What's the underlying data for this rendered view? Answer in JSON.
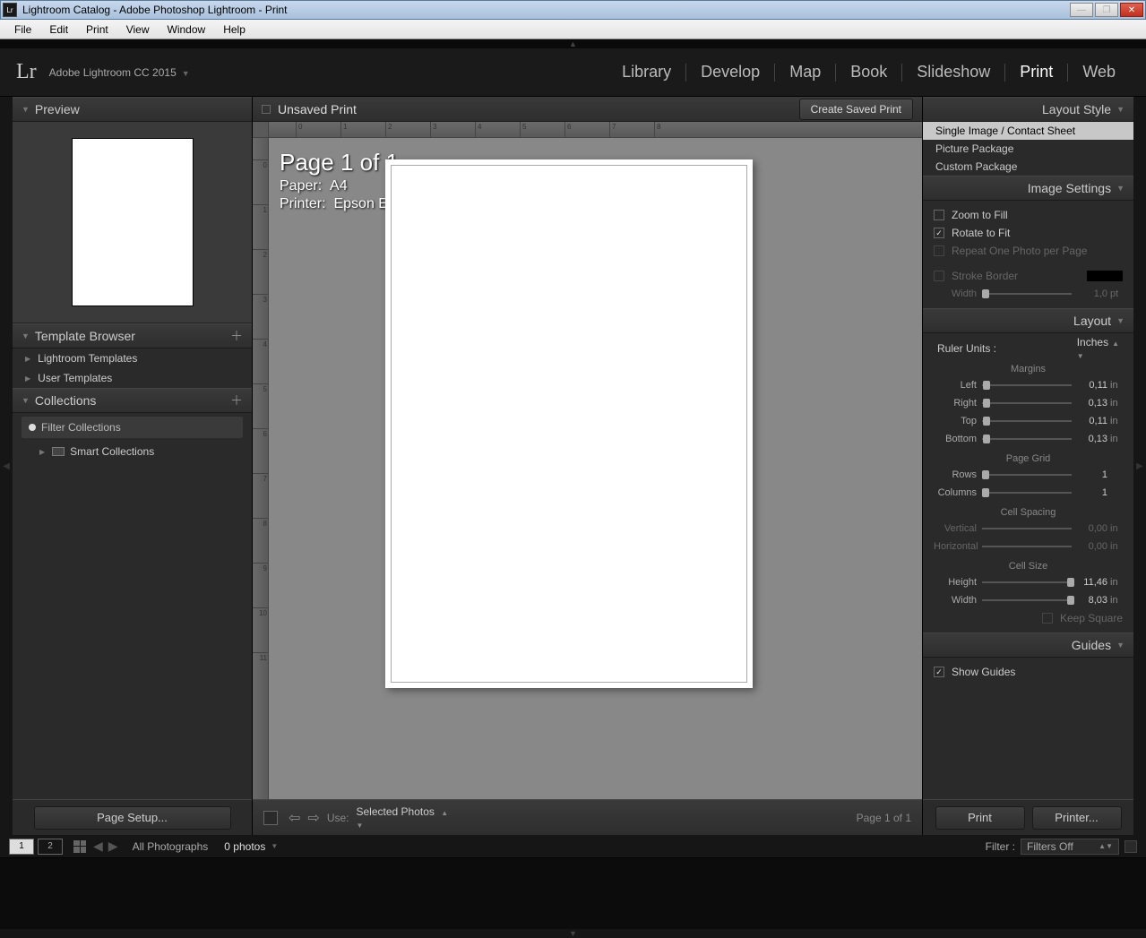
{
  "window": {
    "icon_text": "Lr",
    "title": "Lightroom Catalog - Adobe Photoshop Lightroom - Print"
  },
  "menu": [
    "File",
    "Edit",
    "Print",
    "View",
    "Window",
    "Help"
  ],
  "header": {
    "logo": "Lr",
    "product": "Adobe Lightroom CC 2015",
    "modules": [
      "Library",
      "Develop",
      "Map",
      "Book",
      "Slideshow",
      "Print",
      "Web"
    ],
    "active_module": "Print"
  },
  "left": {
    "preview_title": "Preview",
    "template_browser": "Template Browser",
    "templates": [
      "Lightroom Templates",
      "User Templates"
    ],
    "collections_title": "Collections",
    "filter_placeholder": "Filter Collections",
    "smart_collections": "Smart Collections",
    "page_setup": "Page Setup..."
  },
  "center": {
    "title": "Unsaved Print",
    "save_btn": "Create Saved Print",
    "page_line": "Page 1 of 1",
    "paper_label": "Paper:",
    "paper_value": "A4",
    "printer_label": "Printer:",
    "printer_value": "Epson ESC/P-R",
    "use_label": "Use:",
    "use_value": "Selected Photos",
    "page_status": "Page 1 of 1"
  },
  "right": {
    "layout_style": {
      "title": "Layout Style",
      "items": [
        "Single Image / Contact Sheet",
        "Picture Package",
        "Custom Package"
      ],
      "selected": 0
    },
    "image_settings": {
      "title": "Image Settings",
      "zoom_to_fill": {
        "label": "Zoom to Fill",
        "checked": false
      },
      "rotate_to_fit": {
        "label": "Rotate to Fit",
        "checked": true
      },
      "repeat_one": {
        "label": "Repeat One Photo per Page",
        "checked": false
      },
      "stroke_border": {
        "label": "Stroke Border",
        "checked": false
      },
      "stroke_width": {
        "label": "Width",
        "value": "1,0",
        "unit": "pt"
      }
    },
    "layout": {
      "title": "Layout",
      "ruler_units_label": "Ruler Units :",
      "ruler_units_value": "Inches",
      "margins_title": "Margins",
      "margins": {
        "left": {
          "label": "Left",
          "value": "0,11",
          "unit": "in"
        },
        "right": {
          "label": "Right",
          "value": "0,13",
          "unit": "in"
        },
        "top": {
          "label": "Top",
          "value": "0,11",
          "unit": "in"
        },
        "bottom": {
          "label": "Bottom",
          "value": "0,13",
          "unit": "in"
        }
      },
      "page_grid_title": "Page Grid",
      "rows": {
        "label": "Rows",
        "value": "1"
      },
      "columns": {
        "label": "Columns",
        "value": "1"
      },
      "cell_spacing_title": "Cell Spacing",
      "vertical": {
        "label": "Vertical",
        "value": "0,00",
        "unit": "in"
      },
      "horizontal": {
        "label": "Horizontal",
        "value": "0,00",
        "unit": "in"
      },
      "cell_size_title": "Cell Size",
      "height": {
        "label": "Height",
        "value": "11,46",
        "unit": "in"
      },
      "width": {
        "label": "Width",
        "value": "8,03",
        "unit": "in"
      },
      "keep_square": {
        "label": "Keep Square",
        "checked": false
      }
    },
    "guides": {
      "title": "Guides",
      "show_guides": {
        "label": "Show Guides",
        "checked": true
      }
    },
    "print_btn": "Print",
    "printer_btn": "Printer..."
  },
  "filmstrip": {
    "view1": "1",
    "view2": "2",
    "source": "All Photographs",
    "count": "0 photos",
    "filter_label": "Filter :",
    "filter_value": "Filters Off"
  }
}
